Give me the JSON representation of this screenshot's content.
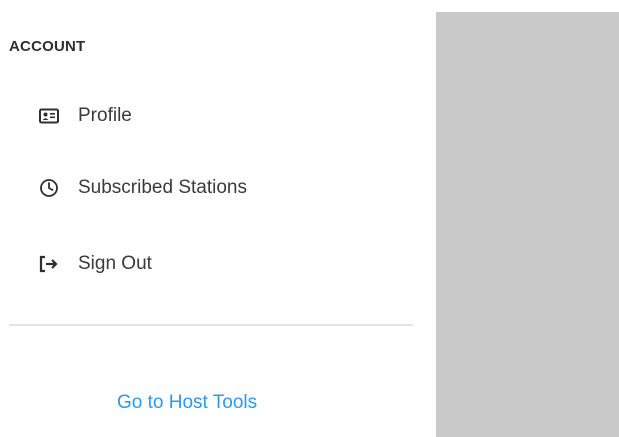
{
  "account": {
    "heading": "ACCOUNT",
    "items": [
      {
        "label": "Profile",
        "icon": "id-card-icon"
      },
      {
        "label": "Subscribed Stations",
        "icon": "clock-icon"
      },
      {
        "label": "Sign Out",
        "icon": "sign-out-icon"
      }
    ]
  },
  "footer": {
    "host_tools_label": "Go to Host Tools"
  },
  "colors": {
    "heading": "#2f2f2f",
    "text": "#3a3a3a",
    "link": "#2d9ae8",
    "divider": "#e3e3e3",
    "overlay_panel": "#c9c9c9"
  }
}
